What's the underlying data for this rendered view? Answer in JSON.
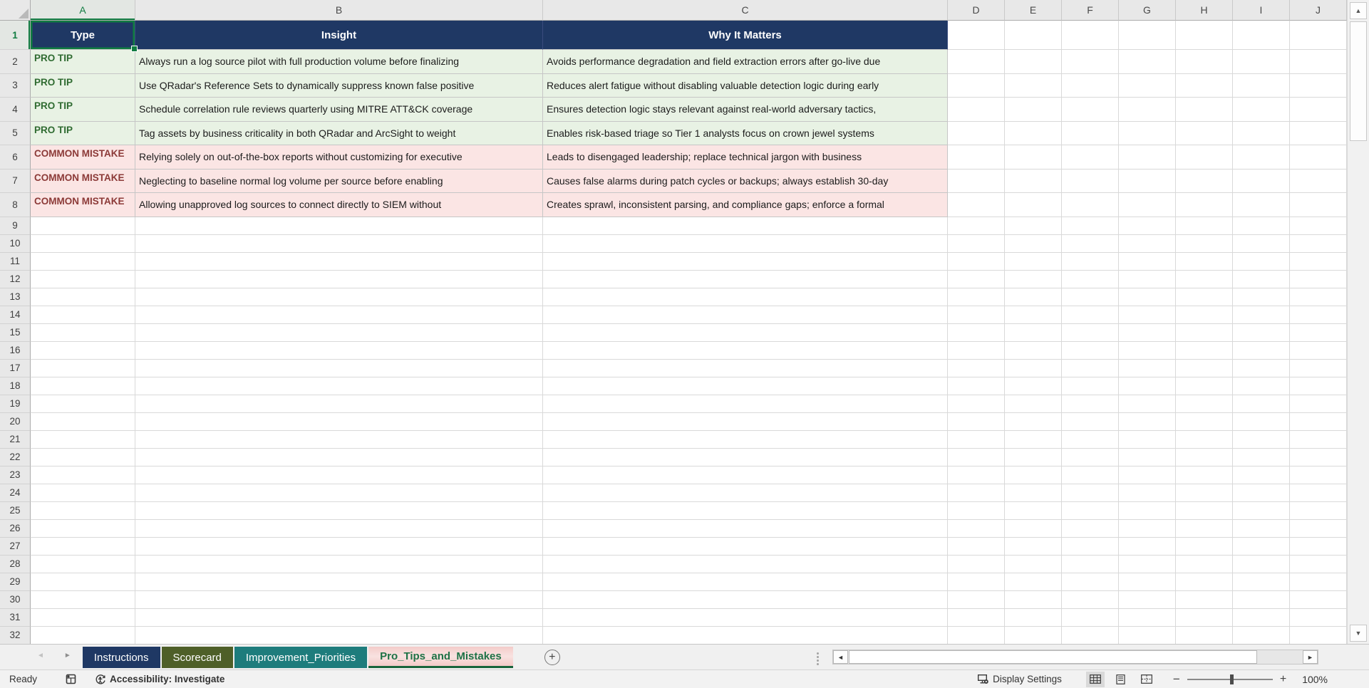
{
  "grid": {
    "columns": [
      "A",
      "B",
      "C",
      "D",
      "E",
      "F",
      "G",
      "H",
      "I",
      "J"
    ],
    "visible_rows": 32,
    "selected_cell": "A1",
    "selected_column": "A",
    "selected_row": "1"
  },
  "table": {
    "headers": {
      "type": "Type",
      "insight": "Insight",
      "why_it_matters": "Why It Matters"
    },
    "rows": [
      {
        "row": 2,
        "kind": "tip",
        "type": "PRO TIP",
        "insight": "Always run a log source pilot with full production volume before finalizing",
        "why": "Avoids performance degradation and field extraction errors after go-live due"
      },
      {
        "row": 3,
        "kind": "tip",
        "type": "PRO TIP",
        "insight": "Use QRadar's Reference Sets to dynamically suppress known false positive",
        "why": "Reduces alert fatigue without disabling valuable detection logic during early"
      },
      {
        "row": 4,
        "kind": "tip",
        "type": "PRO TIP",
        "insight": "Schedule correlation rule reviews quarterly using MITRE ATT&CK coverage",
        "why": "Ensures detection logic stays relevant against real-world adversary tactics,"
      },
      {
        "row": 5,
        "kind": "tip",
        "type": "PRO TIP",
        "insight": "Tag assets by business criticality in both QRadar and ArcSight to weight",
        "why": "Enables risk-based triage so Tier 1 analysts focus on crown jewel systems"
      },
      {
        "row": 6,
        "kind": "mistake",
        "type": "COMMON MISTAKE",
        "insight": "Relying solely on out-of-the-box reports without customizing for executive",
        "why": "Leads to disengaged leadership; replace technical jargon with business"
      },
      {
        "row": 7,
        "kind": "mistake",
        "type": "COMMON MISTAKE",
        "insight": "Neglecting to baseline normal log volume per source before enabling",
        "why": "Causes false alarms during patch cycles or backups; always establish 30-day"
      },
      {
        "row": 8,
        "kind": "mistake",
        "type": "COMMON MISTAKE",
        "insight": "Allowing unapproved log sources to connect directly to SIEM without",
        "why": "Creates sprawl, inconsistent parsing, and compliance gaps; enforce a formal"
      }
    ]
  },
  "sheet_tabs": [
    {
      "label": "Instructions",
      "color": "#1F3864",
      "text_color": "#FFFFFF",
      "active": false
    },
    {
      "label": "Scorecard",
      "color": "#4E5F28",
      "text_color": "#FFFFFF",
      "active": false
    },
    {
      "label": "Improvement_Priorities",
      "color": "#1E7C7C",
      "text_color": "#FFFFFF",
      "active": false
    },
    {
      "label": "Pro_Tips_and_Mistakes",
      "color": "#F2C5C2",
      "text_color": "#1E7145",
      "active": true
    }
  ],
  "status_bar": {
    "mode": "Ready",
    "accessibility": "Accessibility: Investigate",
    "display_settings": "Display Settings",
    "zoom_level": "100%"
  },
  "colors": {
    "header_fill": "#1F3864",
    "header_text": "#FFFFFF",
    "tip_fill": "#E8F2E4",
    "tip_text": "#2F6B31",
    "mistake_fill": "#FBE5E4",
    "mistake_text": "#8C3A38",
    "selection_green": "#107C41",
    "active_tab_underline": "#17643B"
  }
}
